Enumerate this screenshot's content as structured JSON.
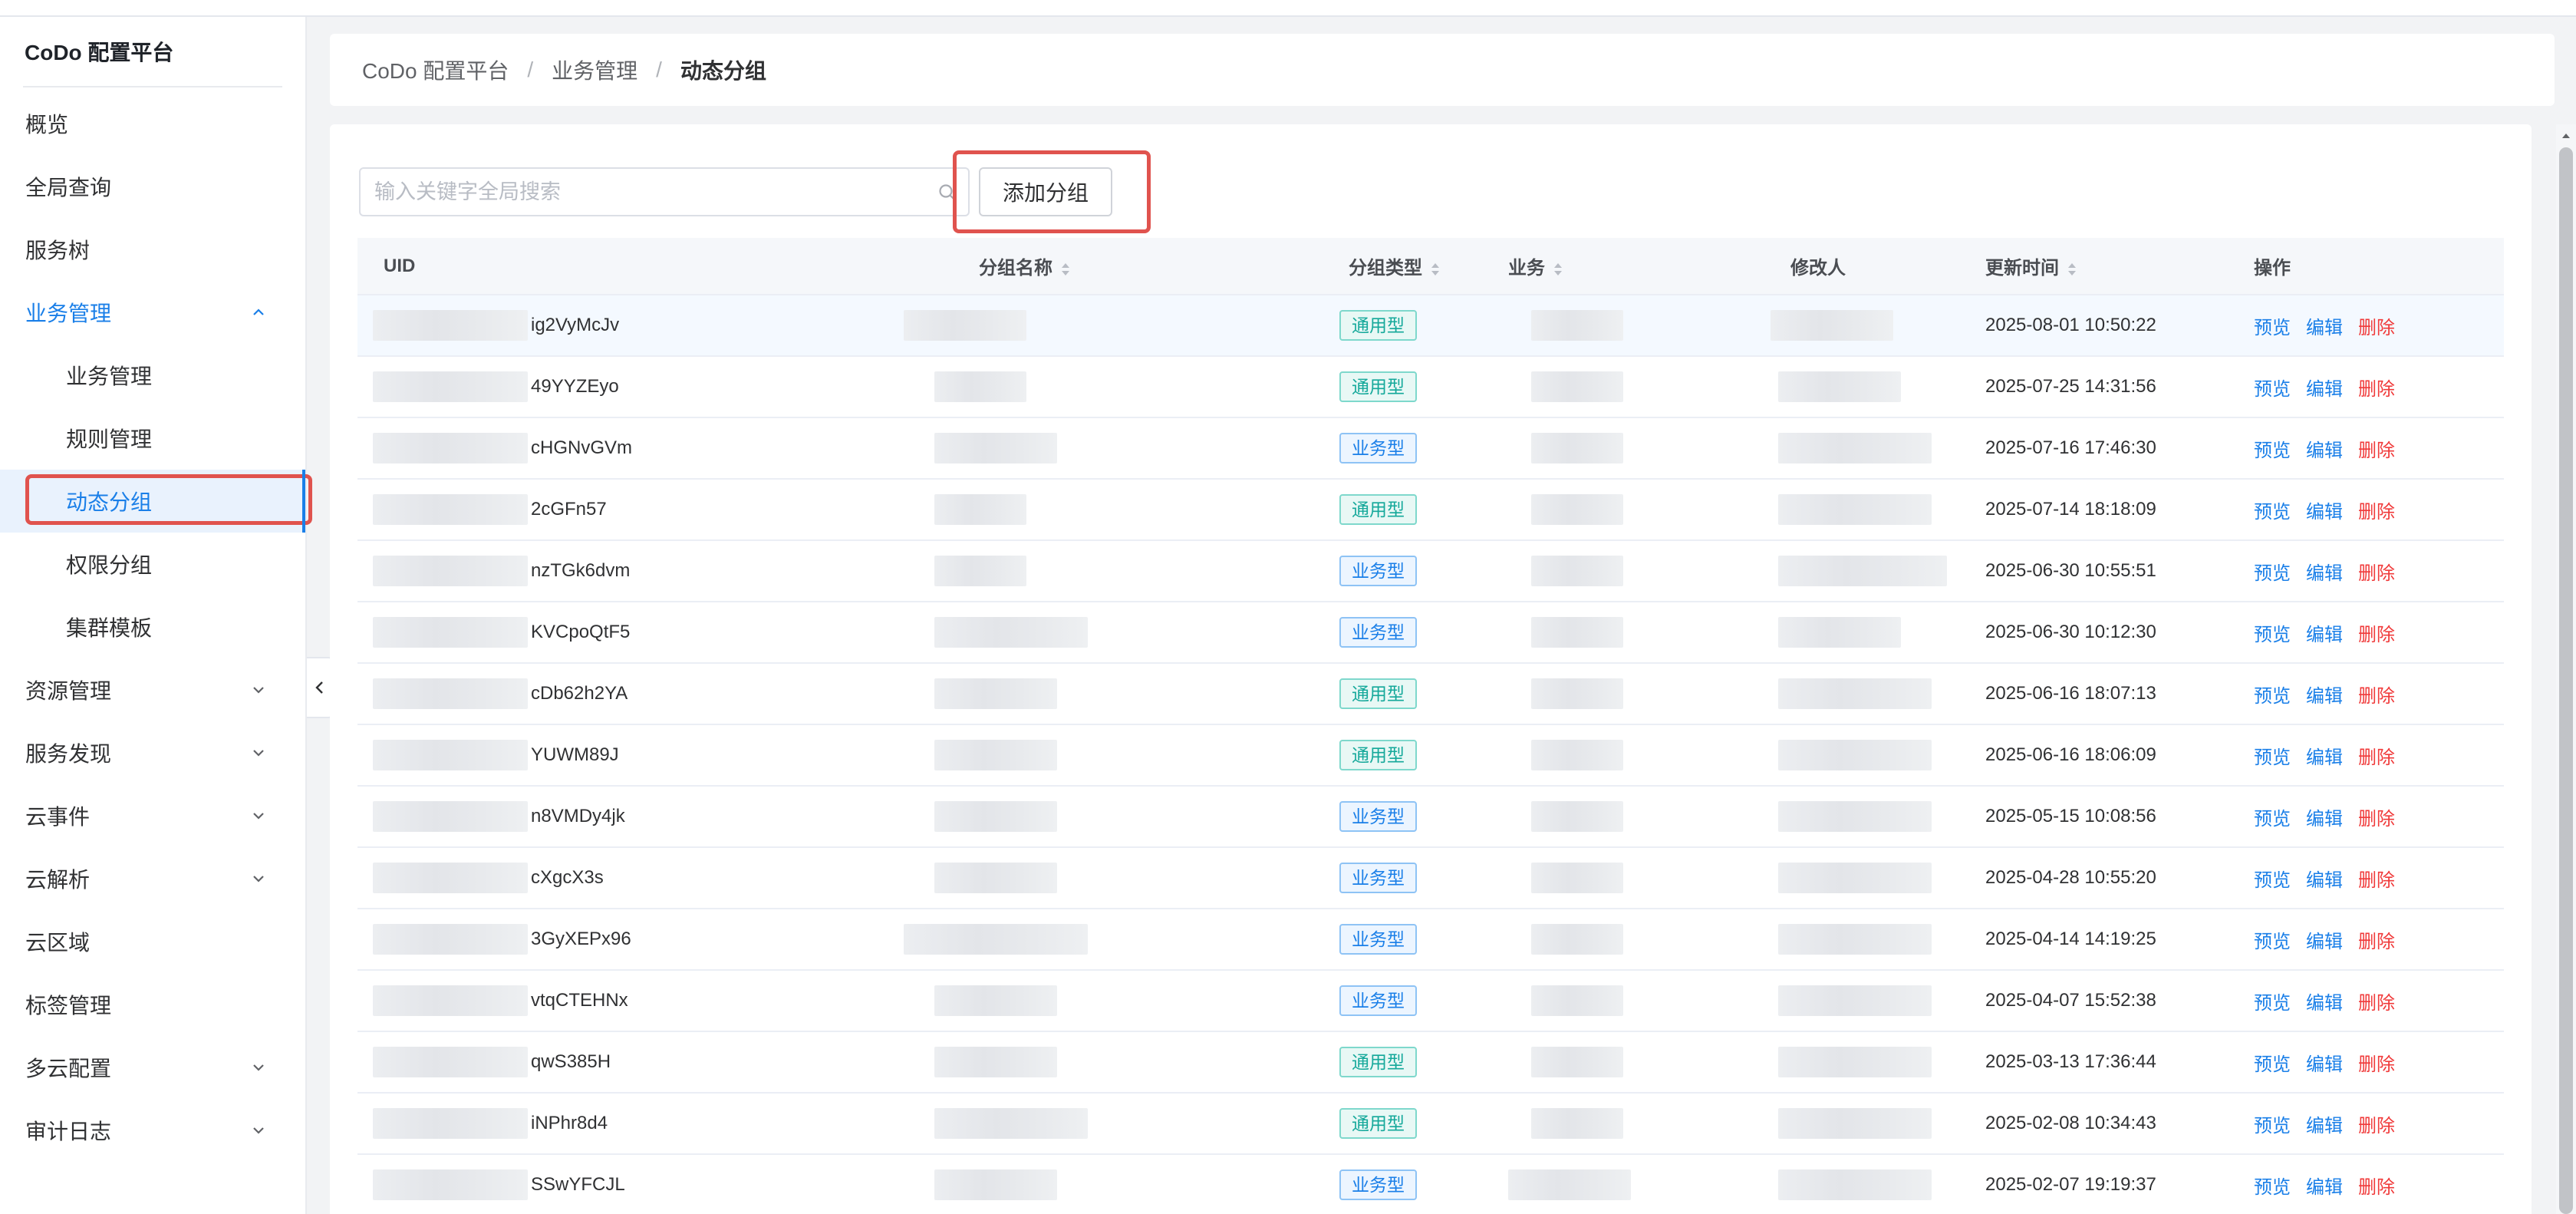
{
  "app": {
    "title": "CoDo 配置平台"
  },
  "sidebar": {
    "items": [
      {
        "label": "概览",
        "expandable": false
      },
      {
        "label": "全局查询",
        "expandable": false
      },
      {
        "label": "服务树",
        "expandable": false
      },
      {
        "label": "业务管理",
        "expandable": true,
        "expanded": true,
        "children": [
          {
            "label": "业务管理"
          },
          {
            "label": "规则管理"
          },
          {
            "label": "动态分组",
            "selected": true
          },
          {
            "label": "权限分组"
          },
          {
            "label": "集群模板"
          }
        ]
      },
      {
        "label": "资源管理",
        "expandable": true
      },
      {
        "label": "服务发现",
        "expandable": true
      },
      {
        "label": "云事件",
        "expandable": true
      },
      {
        "label": "云解析",
        "expandable": true
      },
      {
        "label": "云区域",
        "expandable": false
      },
      {
        "label": "标签管理",
        "expandable": false
      },
      {
        "label": "多云配置",
        "expandable": true
      },
      {
        "label": "审计日志",
        "expandable": true
      }
    ]
  },
  "breadcrumb": [
    "CoDo 配置平台",
    "业务管理",
    "动态分组"
  ],
  "toolbar": {
    "search_placeholder": "输入关键字全局搜索",
    "search_value": "",
    "add_button_label": "添加分组"
  },
  "table": {
    "columns": [
      {
        "label": "UID",
        "sortable": false
      },
      {
        "label": "分组名称",
        "sortable": true
      },
      {
        "label": "分组类型",
        "sortable": true
      },
      {
        "label": "业务",
        "sortable": true
      },
      {
        "label": "修改人",
        "sortable": false
      },
      {
        "label": "更新时间",
        "sortable": true
      },
      {
        "label": "操作",
        "sortable": false
      }
    ],
    "actions": {
      "preview": "预览",
      "edit": "编辑",
      "delete": "删除"
    },
    "type_labels": {
      "generic": "通用型",
      "business": "业务型"
    },
    "rows": [
      {
        "uid_suffix": "ig2VyMcJv",
        "type": "通用型",
        "updated": "2025-08-01 10:50:22"
      },
      {
        "uid_suffix": "49YYZEyo",
        "type": "通用型",
        "updated": "2025-07-25 14:31:56"
      },
      {
        "uid_suffix": "cHGNvGVm",
        "type": "业务型",
        "updated": "2025-07-16 17:46:30"
      },
      {
        "uid_suffix": "2cGFn57",
        "type": "通用型",
        "updated": "2025-07-14 18:18:09"
      },
      {
        "uid_suffix": "nzTGk6dvm",
        "type": "业务型",
        "updated": "2025-06-30 10:55:51"
      },
      {
        "uid_suffix": "KVCpoQtF5",
        "type": "业务型",
        "updated": "2025-06-30 10:12:30"
      },
      {
        "uid_suffix": "cDb62h2YA",
        "type": "通用型",
        "updated": "2025-06-16 18:07:13"
      },
      {
        "uid_suffix": "YUWM89J",
        "type": "通用型",
        "updated": "2025-06-16 18:06:09"
      },
      {
        "uid_suffix": "n8VMDy4jk",
        "type": "业务型",
        "updated": "2025-05-15 10:08:56"
      },
      {
        "uid_suffix": "cXgcX3s",
        "type": "业务型",
        "updated": "2025-04-28 10:55:20"
      },
      {
        "uid_suffix": "3GyXEPx96",
        "type": "业务型",
        "updated": "2025-04-14 14:19:25"
      },
      {
        "uid_suffix": "vtqCTEHNx",
        "type": "业务型",
        "updated": "2025-04-07 15:52:38"
      },
      {
        "uid_suffix": "qwS385H",
        "type": "通用型",
        "updated": "2025-03-13 17:36:44"
      },
      {
        "uid_suffix": "iNPhr8d4",
        "type": "通用型",
        "updated": "2025-02-08 10:34:43"
      },
      {
        "uid_suffix": "SSwYFCJL",
        "type": "业务型",
        "updated": "2025-02-07 19:19:37"
      }
    ]
  },
  "colors": {
    "accent": "#1a7fe8",
    "danger": "#f03a3a",
    "highlight_box": "#e0534e",
    "generic_tag": "#14a89a",
    "business_tag": "#1a7fe8"
  },
  "icons": {
    "search": "search-icon",
    "expand": "chevron-down-icon",
    "collapse": "chevron-up-icon",
    "sidebar_collapse": "chevron-left-icon",
    "sort": "sort-caret-icon"
  }
}
